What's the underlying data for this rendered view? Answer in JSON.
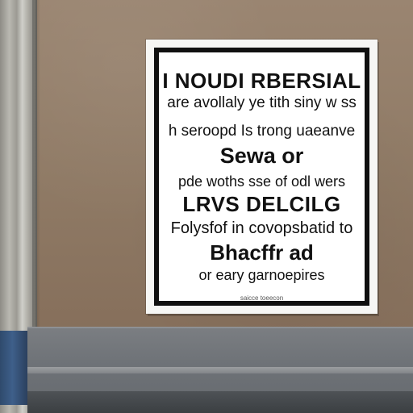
{
  "sign": {
    "lines": [
      "I NOUDI RBERSIAL",
      "are avollaly ye tith siny w ss",
      "h seroopd Is trong uaeanve",
      "Sewa or",
      "pde woths sse of odl wers",
      "LRVS DELCILG",
      "Folysfof in covopsbatid to",
      "Bhacffr ad",
      "or eary garnoepires",
      "saicce toeecon"
    ]
  },
  "colors": {
    "wall": "#8f7a65",
    "sign_border": "#101010",
    "sign_background": "#ffffff",
    "pipe_base": "#3e5f8a"
  }
}
